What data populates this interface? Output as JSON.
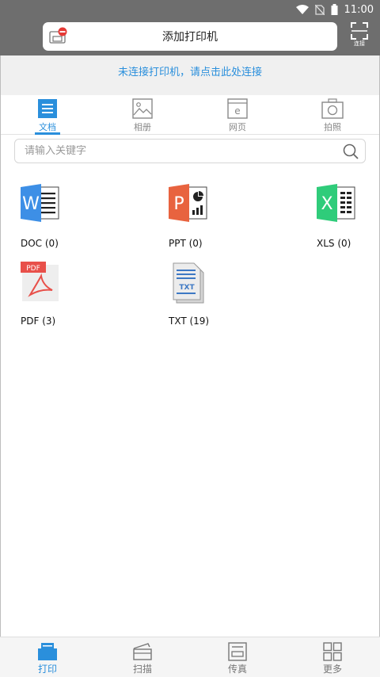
{
  "status_bar": {
    "time": "11:00"
  },
  "header": {
    "add_printer_label": "添加打印机",
    "scan_label": "连接"
  },
  "banner": {
    "text": "未连接打印机，请点击此处连接"
  },
  "tabs": [
    {
      "label": "文档",
      "icon": "document-icon",
      "active": true
    },
    {
      "label": "相册",
      "icon": "photo-icon",
      "active": false
    },
    {
      "label": "网页",
      "icon": "web-icon",
      "active": false
    },
    {
      "label": "拍照",
      "icon": "camera-icon",
      "active": false
    }
  ],
  "search": {
    "placeholder": "请输入关键字",
    "value": ""
  },
  "files": [
    {
      "label": "DOC (0)",
      "type": "word",
      "color": "#3d8fe6"
    },
    {
      "label": "PPT (0)",
      "type": "ppt",
      "color": "#e8633f"
    },
    {
      "label": "XLS (0)",
      "type": "excel",
      "color": "#2fcc7a"
    },
    {
      "label": "PDF (3)",
      "type": "pdf",
      "color": "#e8504a"
    },
    {
      "label": "TXT (19)",
      "type": "txt",
      "color": "#3d78c4"
    }
  ],
  "bottom_nav": [
    {
      "label": "打印",
      "icon": "print-icon",
      "active": true
    },
    {
      "label": "扫描",
      "icon": "scan-icon",
      "active": false
    },
    {
      "label": "传真",
      "icon": "fax-icon",
      "active": false
    },
    {
      "label": "更多",
      "icon": "more-grid-icon",
      "active": false
    }
  ],
  "colors": {
    "accent": "#2a8fdc",
    "header_bg": "#6e6e6e",
    "banner_bg": "#f0f0f0"
  }
}
